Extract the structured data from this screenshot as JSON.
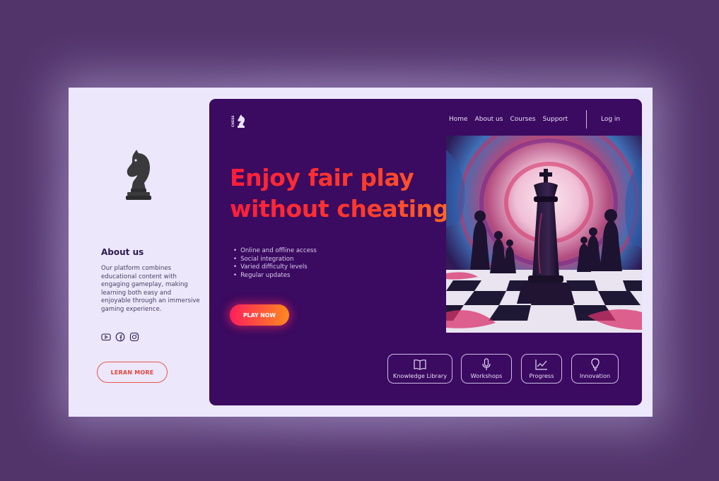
{
  "sidebar": {
    "about_title": "About us",
    "about_text": "Our platform combines educational content with engaging gameplay, making learning both easy and enjoyable through an immersive gaming experience.",
    "socials": [
      "youtube-icon",
      "facebook-icon",
      "instagram-icon"
    ],
    "learn_more_label": "LERAN MORE"
  },
  "header": {
    "logo_text": "CHESS",
    "nav": [
      "Home",
      "About us",
      "Courses",
      "Support"
    ],
    "login_label": "Log in"
  },
  "hero": {
    "title_line1": "Enjoy fair play",
    "title_line2": "without cheating",
    "features": [
      "Online and offline access",
      "Social integration",
      "Varied difficulty levels",
      "Regular updates"
    ],
    "play_label": "PLAY NOW"
  },
  "cards": [
    {
      "label": "Knowledge Library",
      "icon": "book-icon"
    },
    {
      "label": "Workshops",
      "icon": "microphone-icon"
    },
    {
      "label": "Progress",
      "icon": "chart-line-icon"
    },
    {
      "label": "Innovation",
      "icon": "lightbulb-icon"
    }
  ],
  "colors": {
    "background": "#52346b",
    "frame": "#ece7fb",
    "panel": "#3b0a61",
    "accent_red": "#ff1d3b",
    "accent_orange": "#ff8a1e"
  }
}
